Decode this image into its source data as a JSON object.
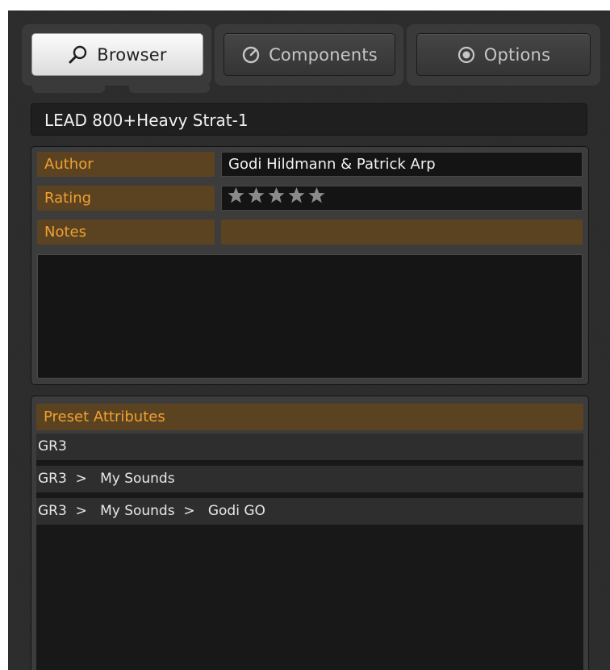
{
  "tabs": {
    "browser": {
      "label": "Browser",
      "icon": "search-icon"
    },
    "components": {
      "label": "Components",
      "icon": "dial-icon"
    },
    "options": {
      "label": "Options",
      "icon": "radio-icon"
    }
  },
  "preset": {
    "name": "LEAD 800+Heavy Strat-1"
  },
  "info": {
    "author_label": "Author",
    "author_value": "Godi Hildmann & Patrick Arp",
    "rating_label": "Rating",
    "rating_value": 0,
    "rating_max": 5,
    "notes_label": "Notes",
    "notes_value": ""
  },
  "attributes": {
    "header": "Preset Attributes",
    "rows": [
      "GR3",
      "GR3  >   My Sounds",
      "GR3  >   My Sounds  >   Godi GO"
    ]
  },
  "colors": {
    "accent_text": "#f0a030",
    "label_bg": "#5b4322",
    "panel_bg": "#2b2b2b"
  }
}
